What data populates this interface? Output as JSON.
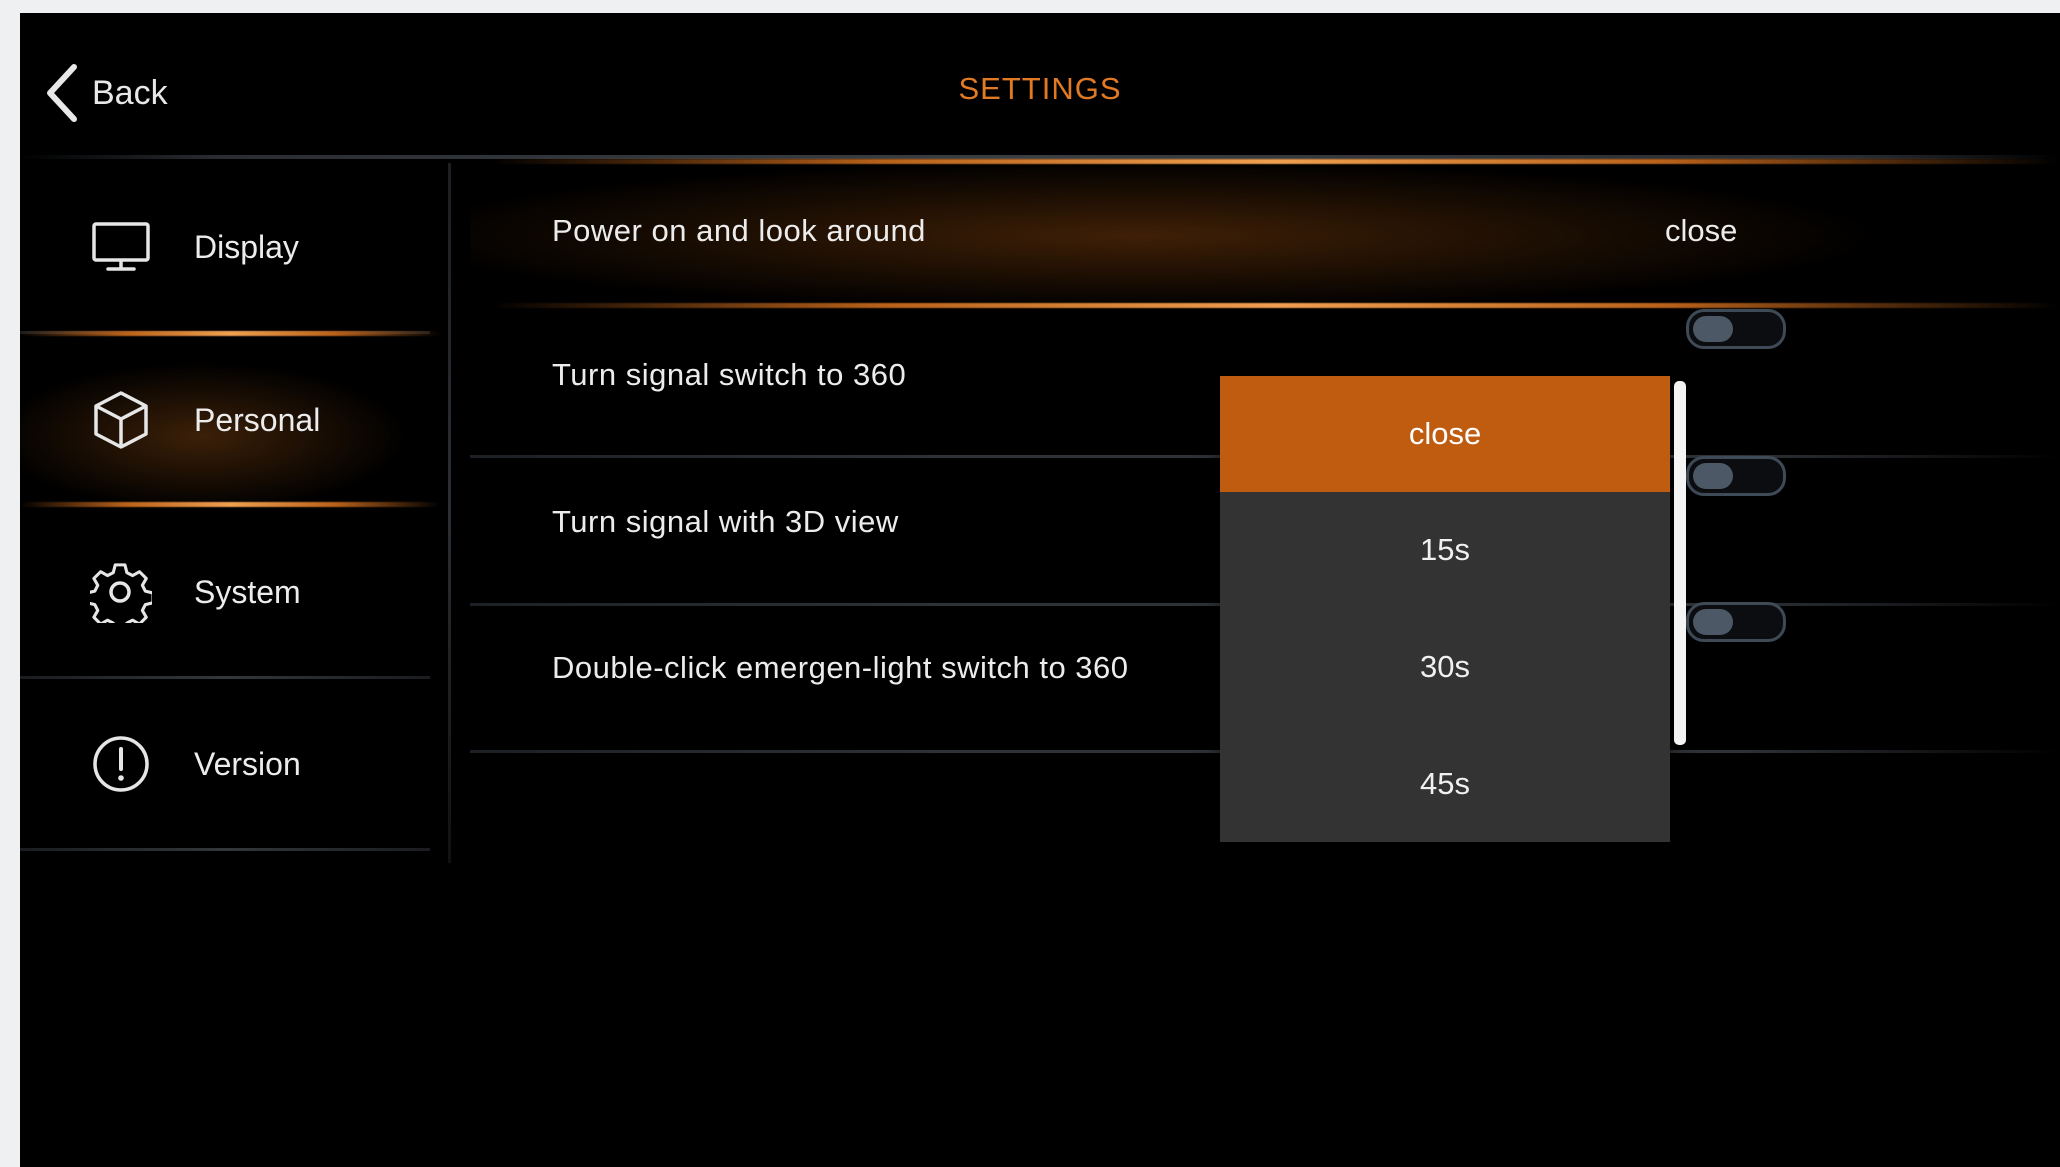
{
  "header": {
    "back_label": "Back",
    "title": "SETTINGS"
  },
  "sidebar": {
    "items": [
      {
        "label": "Display",
        "icon": "monitor-icon"
      },
      {
        "label": "Personal",
        "icon": "cube-icon",
        "active": true
      },
      {
        "label": "System",
        "icon": "gear-icon"
      },
      {
        "label": "Version",
        "icon": "info-icon"
      }
    ]
  },
  "settings": {
    "rows": [
      {
        "label": "Power on and look around",
        "value": "close",
        "control": "dropdown",
        "active": true
      },
      {
        "label": "Turn signal switch to 360",
        "control": "toggle",
        "on": false
      },
      {
        "label": "Turn signal with 3D view",
        "control": "toggle",
        "on": false
      },
      {
        "label": "Double-click emergen-light switch to 360",
        "control": "toggle",
        "on": false
      }
    ]
  },
  "dropdown": {
    "options": [
      "close",
      "15s",
      "30s",
      "45s"
    ],
    "selected": "close"
  },
  "colors": {
    "accent": "#c05c10",
    "title": "#e07a24",
    "background": "#000000",
    "dropdown_bg": "#333333"
  }
}
